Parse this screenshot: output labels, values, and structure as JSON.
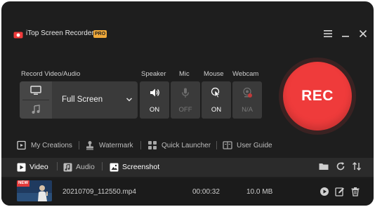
{
  "app": {
    "title": "iTop Screen Recorder",
    "badge": "PRO"
  },
  "colors": {
    "rec": "#ef3b3b",
    "background": "#1e1e1e",
    "badge": "#f0a93a",
    "new_badge": "#e23a3a"
  },
  "window_controls": [
    "menu-icon",
    "minimize-icon",
    "close-icon"
  ],
  "record": {
    "section_label": "Record Video/Audio",
    "mode_label": "Full Screen",
    "source_icons": [
      "monitor-icon",
      "music-note-icon"
    ]
  },
  "devices": [
    {
      "label": "Speaker",
      "state": "ON",
      "icon": "speaker-icon",
      "enabled": true
    },
    {
      "label": "Mic",
      "state": "OFF",
      "icon": "mic-icon",
      "enabled": false
    },
    {
      "label": "Mouse",
      "state": "ON",
      "icon": "mouse-icon",
      "enabled": true
    },
    {
      "label": "Webcam",
      "state": "N/A",
      "icon": "webcam-icon",
      "enabled": false
    }
  ],
  "rec_button": {
    "label": "REC"
  },
  "tools": [
    {
      "label": "My Creations",
      "icon": "folder-video-icon"
    },
    {
      "label": "Watermark",
      "icon": "stamp-icon"
    },
    {
      "label": "Quick Launcher",
      "icon": "grid-icon"
    },
    {
      "label": "User Guide",
      "icon": "book-icon"
    }
  ],
  "tabs": [
    {
      "label": "Video",
      "icon": "video-icon",
      "active": true
    },
    {
      "label": "Audio",
      "icon": "audio-icon",
      "active": false
    },
    {
      "label": "Screenshot",
      "icon": "screenshot-icon",
      "active": false
    }
  ],
  "list_actions": [
    "folder-icon",
    "refresh-icon",
    "sort-icon"
  ],
  "files": [
    {
      "badge": "NEW",
      "name": "20210709_112550.mp4",
      "duration": "00:00:32",
      "size": "10.0 MB",
      "actions": [
        "play-icon",
        "edit-icon",
        "delete-icon"
      ]
    }
  ]
}
